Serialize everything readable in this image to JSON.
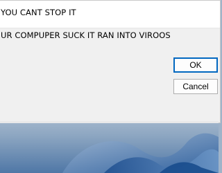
{
  "dialog": {
    "title": "YOU CANT STOP IT",
    "message": "UR COMPUPER SUCK IT RAN INTO VIROOS",
    "buttons": {
      "ok_label": "OK",
      "cancel_label": "Cancel"
    }
  },
  "colors": {
    "accent": "#0067c0",
    "dialog_bg": "#f0f0f0",
    "titlebar_bg": "#ffffff"
  }
}
